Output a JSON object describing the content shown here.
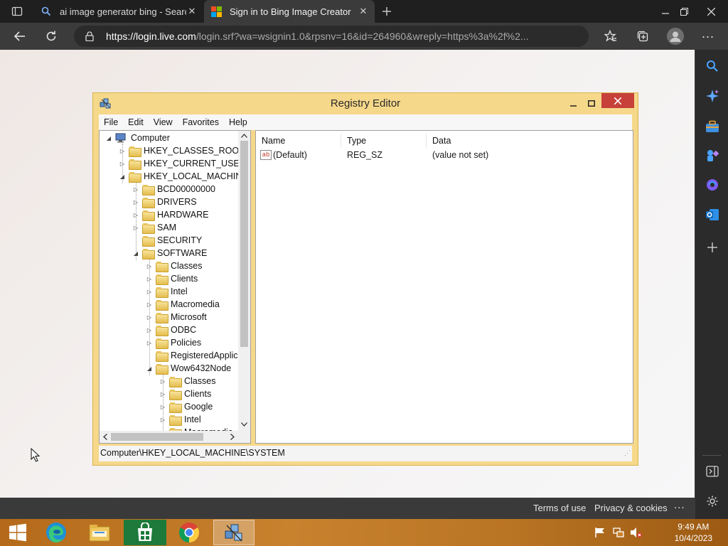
{
  "browser": {
    "tabs": [
      {
        "title": "ai image generator bing - Search"
      },
      {
        "title": "Sign in to Bing Image Creator"
      }
    ],
    "url_domain": "https://login.live.com",
    "url_rest": "/login.srf?wa=wsignin1.0&rpsnv=16&id=264960&wreply=https%3a%2f%2...",
    "footer": {
      "terms": "Terms of use",
      "privacy": "Privacy & cookies",
      "more": "..."
    }
  },
  "sidebar_icons": [
    "search-icon",
    "copilot-icon",
    "tools-icon",
    "games-icon",
    "office-icon",
    "outlook-icon",
    "add-icon",
    "collapse-icon",
    "settings-icon"
  ],
  "registry": {
    "title": "Registry Editor",
    "menu": [
      "File",
      "Edit",
      "View",
      "Favorites",
      "Help"
    ],
    "tree": [
      {
        "label": "Computer",
        "level": 0,
        "exp": "open",
        "icon": "computer"
      },
      {
        "label": "HKEY_CLASSES_ROOT",
        "level": 1,
        "exp": "closed"
      },
      {
        "label": "HKEY_CURRENT_USER",
        "level": 1,
        "exp": "closed"
      },
      {
        "label": "HKEY_LOCAL_MACHINE",
        "level": 1,
        "exp": "open"
      },
      {
        "label": "BCD00000000",
        "level": 2,
        "exp": "closed"
      },
      {
        "label": "DRIVERS",
        "level": 2,
        "exp": "closed"
      },
      {
        "label": "HARDWARE",
        "level": 2,
        "exp": "closed"
      },
      {
        "label": "SAM",
        "level": 2,
        "exp": "closed"
      },
      {
        "label": "SECURITY",
        "level": 2,
        "exp": "none"
      },
      {
        "label": "SOFTWARE",
        "level": 2,
        "exp": "open"
      },
      {
        "label": "Classes",
        "level": 3,
        "exp": "closed"
      },
      {
        "label": "Clients",
        "level": 3,
        "exp": "closed"
      },
      {
        "label": "Intel",
        "level": 3,
        "exp": "closed"
      },
      {
        "label": "Macromedia",
        "level": 3,
        "exp": "closed"
      },
      {
        "label": "Microsoft",
        "level": 3,
        "exp": "closed"
      },
      {
        "label": "ODBC",
        "level": 3,
        "exp": "closed"
      },
      {
        "label": "Policies",
        "level": 3,
        "exp": "closed"
      },
      {
        "label": "RegisteredApplica",
        "level": 3,
        "exp": "none"
      },
      {
        "label": "Wow6432Node",
        "level": 3,
        "exp": "open"
      },
      {
        "label": "Classes",
        "level": 4,
        "exp": "closed"
      },
      {
        "label": "Clients",
        "level": 4,
        "exp": "closed"
      },
      {
        "label": "Google",
        "level": 4,
        "exp": "closed"
      },
      {
        "label": "Intel",
        "level": 4,
        "exp": "closed"
      },
      {
        "label": "Macromedia",
        "level": 4,
        "exp": "closed"
      }
    ],
    "columns": [
      "Name",
      "Type",
      "Data"
    ],
    "values": [
      {
        "name": "(Default)",
        "type": "REG_SZ",
        "data": "(value not set)"
      }
    ],
    "status": "Computer\\HKEY_LOCAL_MACHINE\\SYSTEM"
  },
  "taskbar": {
    "apps": [
      "windows-start-icon",
      "edge-icon",
      "file-explorer-icon",
      "store-icon",
      "chrome-icon",
      "regedit-icon"
    ],
    "time": "9:49 AM",
    "date": "10/4/2023"
  }
}
